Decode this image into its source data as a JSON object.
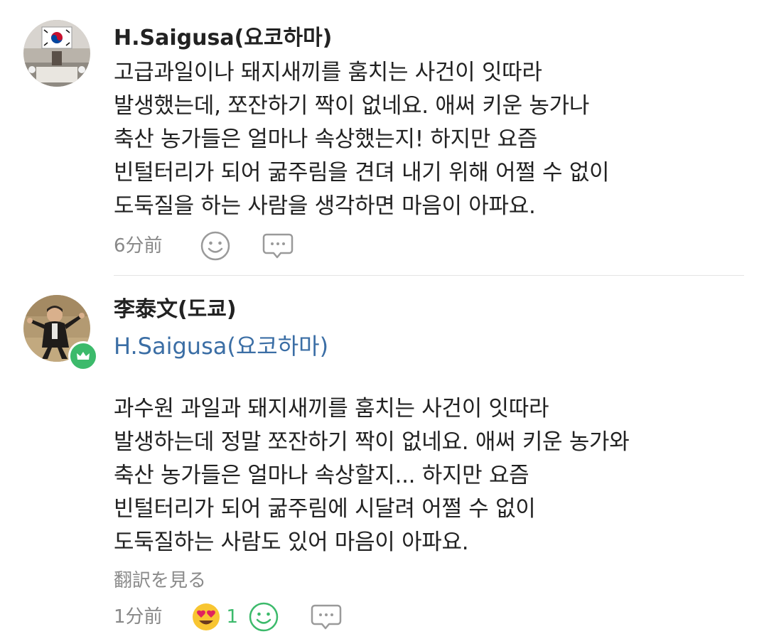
{
  "comments": [
    {
      "author": "H.Saigusa(요코하마)",
      "text": "고급과일이나 돼지새끼를 훔치는 사건이 잇따라\n발생했는데, 쪼잔하기 짝이 없네요. 애써 키운 농가나\n축산 농가들은  얼마나 속상했는지! 하지만 요즘\n빈털터리가 되어 굶주림을 견뎌 내기 위해 어쩔 수 없이\n도둑질을 하는 사람을 생각하면 마음이 아파요.",
      "time": "6分前",
      "icons": [
        "smile-icon",
        "reply-bubble-icon"
      ]
    },
    {
      "author": "李泰文(도쿄)",
      "reply_to": "H.Saigusa(요코하마)",
      "text": "과수원 과일과 돼지새끼를 훔치는 사건이 잇따라\n발생하는데 정말 쪼잔하기 짝이 없네요. 애써 키운 농가와\n축산 농가들은 얼마나 속상할지... 하지만 요즘\n빈털터리가 되어 굶주림에 시달려 어쩔 수 없이\n도둑질하는 사람도 있어 마음이 아파요.",
      "translate_label": "翻訳を見る",
      "time": "1分前",
      "reaction_count": "1",
      "icons": [
        "heart-eyes-emoji-icon",
        "smile-icon",
        "reply-bubble-icon"
      ],
      "badge_icon": "crown-icon",
      "colors": {
        "badge": "#3cba6b",
        "reply_to": "#3b6ea5"
      }
    }
  ]
}
